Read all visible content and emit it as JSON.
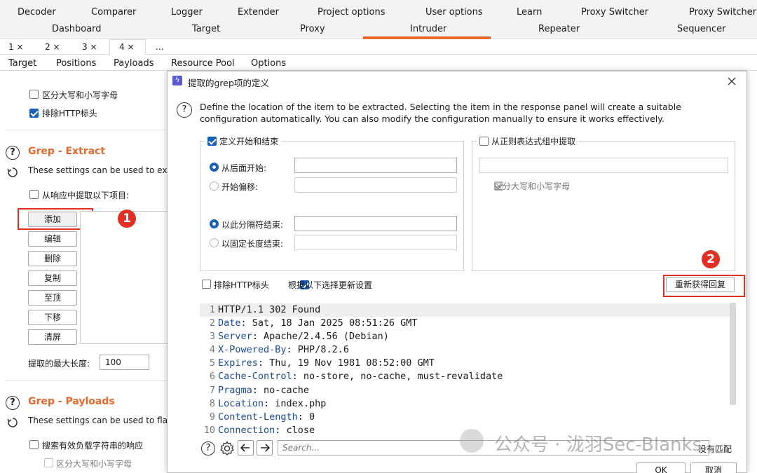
{
  "top_tabs_row1": [
    "Decoder",
    "Comparer",
    "Logger",
    "Extender",
    "Project options",
    "User options",
    "Learn",
    "Proxy Switcher",
    "Proxy Switcher"
  ],
  "top_tabs_row2": [
    "Dashboard",
    "Target",
    "Proxy",
    "Intruder",
    "Repeater",
    "Sequencer"
  ],
  "intruder_tabs": [
    "1 ×",
    "2 ×",
    "3 ×",
    "4 ×",
    "..."
  ],
  "sub_tabs": [
    "Target",
    "Positions",
    "Payloads",
    "Resource Pool",
    "Options"
  ],
  "left": {
    "case_sensitive": "区分大写和小写字母",
    "exclude_http": "排除HTTP标头",
    "grep_extract_title": "Grep - Extract",
    "grep_extract_desc": "These settings can be used to extr",
    "extract_from_response": "从响应中提取以下项目:",
    "buttons": [
      "添加",
      "编辑",
      "删除",
      "复制",
      "至顶",
      "下移",
      "清屏"
    ],
    "max_length_label": "提取的最大长度:",
    "max_length_value": "100",
    "grep_payloads_title": "Grep - Payloads",
    "grep_payloads_desc": "These settings can be used to flag",
    "search_payload": "搜索有效负载字符串的响应",
    "case_sensitive2": "区分大写和小写字母"
  },
  "dialog": {
    "title": "提取的grep项的定义",
    "desc": "Define the location of the item to be extracted. Selecting the item in the response panel will create a suitable configuration automatically. You can also modify the configuration manually to ensure it works effectively.",
    "define_start_end": "定义开始和结束",
    "start_after": "从后面开始:",
    "start_offset": "开始偏移:",
    "end_delimiter": "以此分隔符结束:",
    "end_fixed": "以固定长度结束:",
    "regex_group": "从正则表达式组中提取",
    "regex_case": "区分大写和小写字母",
    "exclude_http": "排除HTTP标头",
    "update_config": "根据以下选择更新设置",
    "refetch_button": "重新获得回复",
    "response_lines": [
      {
        "n": "1",
        "k": "",
        "v": "HTTP/1.1 302 Found"
      },
      {
        "n": "2",
        "k": "Date",
        "v": ": Sat, 18 Jan 2025 08:51:26 GMT"
      },
      {
        "n": "3",
        "k": "Server",
        "v": ": Apache/2.4.56 (Debian)"
      },
      {
        "n": "4",
        "k": "X-Powered-By",
        "v": ": PHP/8.2.6"
      },
      {
        "n": "5",
        "k": "Expires",
        "v": ": Thu, 19 Nov 1981 08:52:00 GMT"
      },
      {
        "n": "6",
        "k": "Cache-Control",
        "v": ": no-store, no-cache, must-revalidate"
      },
      {
        "n": "7",
        "k": "Pragma",
        "v": ": no-cache"
      },
      {
        "n": "8",
        "k": "Location",
        "v": ": index.php"
      },
      {
        "n": "9",
        "k": "Content-Length",
        "v": ": 0"
      },
      {
        "n": "10",
        "k": "Connection",
        "v": ": close"
      }
    ],
    "search_placeholder": "Search...",
    "no_match": "没有匹配",
    "ok": "OK",
    "cancel": "取消"
  },
  "annotations": [
    "1",
    "2"
  ],
  "watermark": "公众号 · 泷羽Sec-Blanks",
  "colors": {
    "accent": "#e8672a",
    "annotation": "#e03024",
    "checkbox": "#1a5fb4"
  }
}
